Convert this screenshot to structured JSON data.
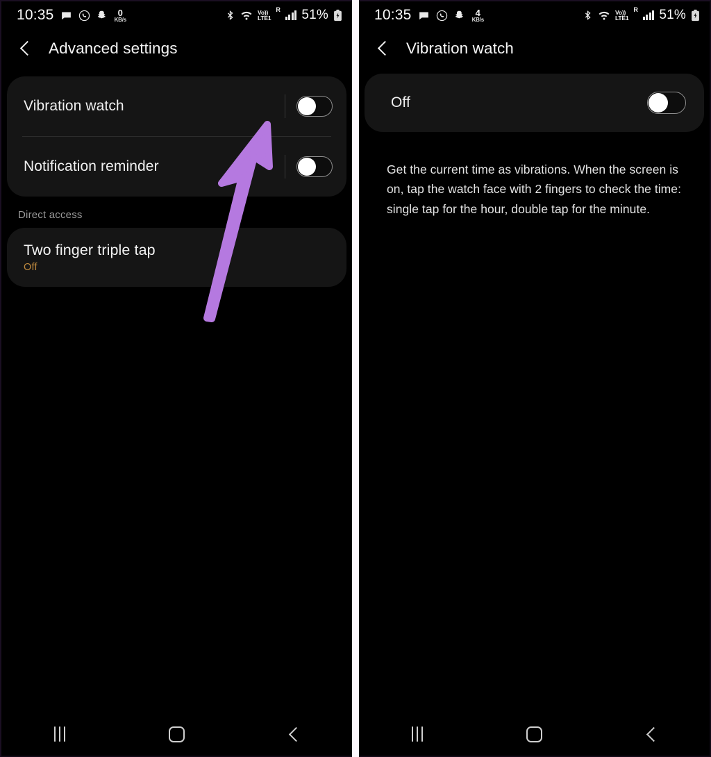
{
  "meta": {
    "accent_purple": "#b579e0",
    "card_bg": "#151515",
    "screen_bg": "#000000",
    "off_value_color": "#c08a3e"
  },
  "left_phone": {
    "status_bar": {
      "clock": "10:35",
      "icons_left": [
        "message-icon",
        "whatsapp-icon",
        "snapchat-icon"
      ],
      "network_speed_value": "0",
      "network_speed_unit": "KB/s",
      "icons_right": [
        "bluetooth-icon",
        "wifi-icon",
        "volte-icon",
        "roaming-icon",
        "signal-bars-icon"
      ],
      "volte_top": "Vo))",
      "volte_bottom": "LTE1",
      "roaming": "R",
      "battery_percent": "51%",
      "battery_icon": "battery-charging-icon"
    },
    "header": {
      "back_icon": "back-chevron-icon",
      "title": "Advanced settings"
    },
    "settings_rows": [
      {
        "label": "Vibration watch",
        "toggle_state": "off"
      },
      {
        "label": "Notification reminder",
        "toggle_state": "off"
      }
    ],
    "section": {
      "title": "Direct access"
    },
    "direct_access_item": {
      "label": "Two finger triple tap",
      "value": "Off"
    },
    "nav_bar": {
      "recents": "recents-icon",
      "home": "home-icon",
      "back": "back-icon"
    },
    "annotation": {
      "type": "arrow",
      "color": "#b579e0",
      "points_to": "Vibration watch toggle"
    }
  },
  "right_phone": {
    "status_bar": {
      "clock": "10:35",
      "icons_left": [
        "message-icon",
        "whatsapp-icon",
        "snapchat-icon"
      ],
      "network_speed_value": "4",
      "network_speed_unit": "KB/s",
      "icons_right": [
        "bluetooth-icon",
        "wifi-icon",
        "volte-icon",
        "roaming-icon",
        "signal-bars-icon"
      ],
      "volte_top": "Vo))",
      "volte_bottom": "LTE1",
      "roaming": "R",
      "battery_percent": "51%",
      "battery_icon": "battery-charging-icon"
    },
    "header": {
      "back_icon": "back-chevron-icon",
      "title": "Vibration watch"
    },
    "master_toggle": {
      "label": "Off",
      "toggle_state": "off"
    },
    "description": "Get the current time as vibrations. When the screen is on, tap the watch face with 2 fingers to check the time: single tap for the hour, double tap for the minute.",
    "nav_bar": {
      "recents": "recents-icon",
      "home": "home-icon",
      "back": "back-icon"
    }
  }
}
